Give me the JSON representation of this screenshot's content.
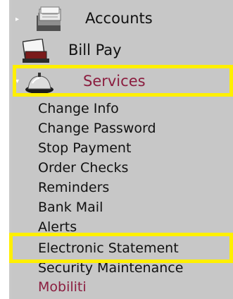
{
  "menu": {
    "top_items": [
      {
        "label": "Accounts",
        "icon": "accounts-icon",
        "expander": "▸"
      },
      {
        "label": "Bill Pay",
        "icon": "bill-pay-icon"
      },
      {
        "label": "Services",
        "icon": "service-bell-icon",
        "expander": "▾",
        "active": true
      }
    ],
    "services_items": [
      {
        "label": "Change Info"
      },
      {
        "label": "Change Password"
      },
      {
        "label": "Stop Payment"
      },
      {
        "label": "Order Checks"
      },
      {
        "label": "Reminders"
      },
      {
        "label": "Bank Mail"
      },
      {
        "label": "Alerts"
      },
      {
        "label": "Electronic Statement",
        "highlighted": true
      },
      {
        "label": "Security Maintenance"
      },
      {
        "label": "Mobiliti"
      }
    ]
  },
  "colors": {
    "menu_background": "#c7c7c7",
    "highlight": "#ffef00",
    "active_text": "#8b1d3f",
    "normal_text": "#111111"
  }
}
